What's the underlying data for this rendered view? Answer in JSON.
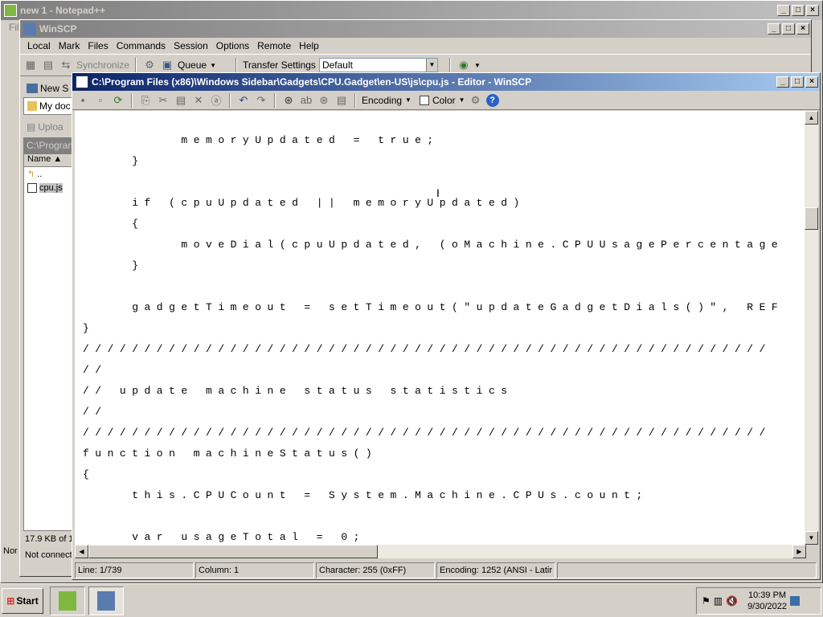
{
  "notepad": {
    "title": "new 1 - Notepad++",
    "menu_fragment": "Fil"
  },
  "winscp": {
    "title": "WinSCP",
    "menu": [
      "Local",
      "Mark",
      "Files",
      "Commands",
      "Session",
      "Options",
      "Remote",
      "Help"
    ],
    "toolbar": {
      "synchronize": "Synchronize",
      "queue": "Queue",
      "transfer_settings_label": "Transfer Settings",
      "transfer_settings_value": "Default"
    },
    "left_panel": {
      "new_label": "New S",
      "folder_label": "My doc",
      "upload_label": "Uploa",
      "path": "C:\\Program",
      "column_name": "Name",
      "files": [
        "..",
        "cpu.js"
      ],
      "size_info": "17.9 KB of 1",
      "connection": "Not connect",
      "status_left": "Nor"
    }
  },
  "editor": {
    "title": "C:\\Program Files (x86)\\Windows Sidebar\\Gadgets\\CPU.Gadget\\en-US\\js\\cpu.js - Editor - WinSCP",
    "encoding_label": "Encoding",
    "color_label": "Color",
    "lines": [
      "        memoryUpdated = true;",
      "    }",
      "",
      "    if (cpuUpdated || memoryUpdated)",
      "    {",
      "        moveDial(cpuUpdated, (oMachine.CPUUsagePercentage",
      "    }",
      "",
      "    gadgetTimeout = setTimeout(\"updateGadgetDials()\", REF",
      "}",
      "////////////////////////////////////////////////////////",
      "//",
      "// update machine status statistics",
      "//",
      "////////////////////////////////////////////////////////",
      "function machineStatus()",
      "{",
      "    this.CPUCount = System.Machine.CPUs.count;",
      "",
      "    var usageTotal = 0;"
    ],
    "status": {
      "line": "Line: 1/739",
      "column": "Column: 1",
      "character": "Character: 255 (0xFF)",
      "encoding": "Encoding: 1252  (ANSI - Latir"
    }
  },
  "taskbar": {
    "start": "Start",
    "time": "10:39 PM",
    "date": "9/30/2022"
  }
}
